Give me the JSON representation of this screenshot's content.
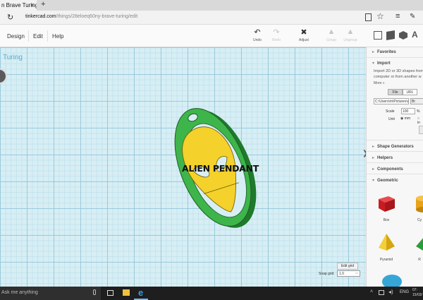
{
  "browser": {
    "tab_title": "n Brave Turing",
    "tab_close": "×",
    "new_tab": "+",
    "url_host": "tinkercad.com",
    "url_path": "/things/28eloeq60ny-brave-turing/edit"
  },
  "toolbar": {
    "menus": [
      "Design",
      "Edit",
      "Help"
    ],
    "undo": "Undo",
    "redo": "Redo",
    "adjust": "Adjust",
    "group": "Group",
    "ungroup": "Ungroup",
    "view_letter": "A"
  },
  "workplane": {
    "design_title": "Turing",
    "pendant_text": "ALIEN PENDANT",
    "edit_grid": "Edit grid",
    "snap_label": "Snap grid",
    "snap_value": "1.0"
  },
  "panel": {
    "favorites": "Favorites",
    "import": "Import",
    "import_desc": "Import 2D or 3D shapes from computer or from another w",
    "import_more": "More »",
    "file_tab": "File",
    "url_tab": "URL",
    "path_value": "C:\\Users\\m\\Pictures\\ar",
    "browse_text": "Br",
    "scale_label": "Scale",
    "scale_value": "100",
    "scale_unit": "%",
    "unit_label": "Unit",
    "unit_mm": "mm",
    "unit_in": "in",
    "shape_generators": "Shape Generators",
    "helpers": "Helpers",
    "components": "Components",
    "geometric": "Geometric",
    "shapes": [
      {
        "label": "Box",
        "color": "#d8232a"
      },
      {
        "label": "Cy",
        "color": "#e8a317"
      },
      {
        "label": "Pyramid",
        "color": "#f2c21b"
      },
      {
        "label": "R",
        "color": "#2e9b3a"
      }
    ]
  },
  "taskbar": {
    "search_placeholder": "Ask me anything",
    "language": "ENG",
    "time": "07:",
    "date": "15/03/"
  },
  "colors": {
    "pendant_ring": "#3db54a",
    "pendant_face": "#f4d12b",
    "grid_bg": "#d7eef4",
    "accent": "#5aaec8"
  }
}
